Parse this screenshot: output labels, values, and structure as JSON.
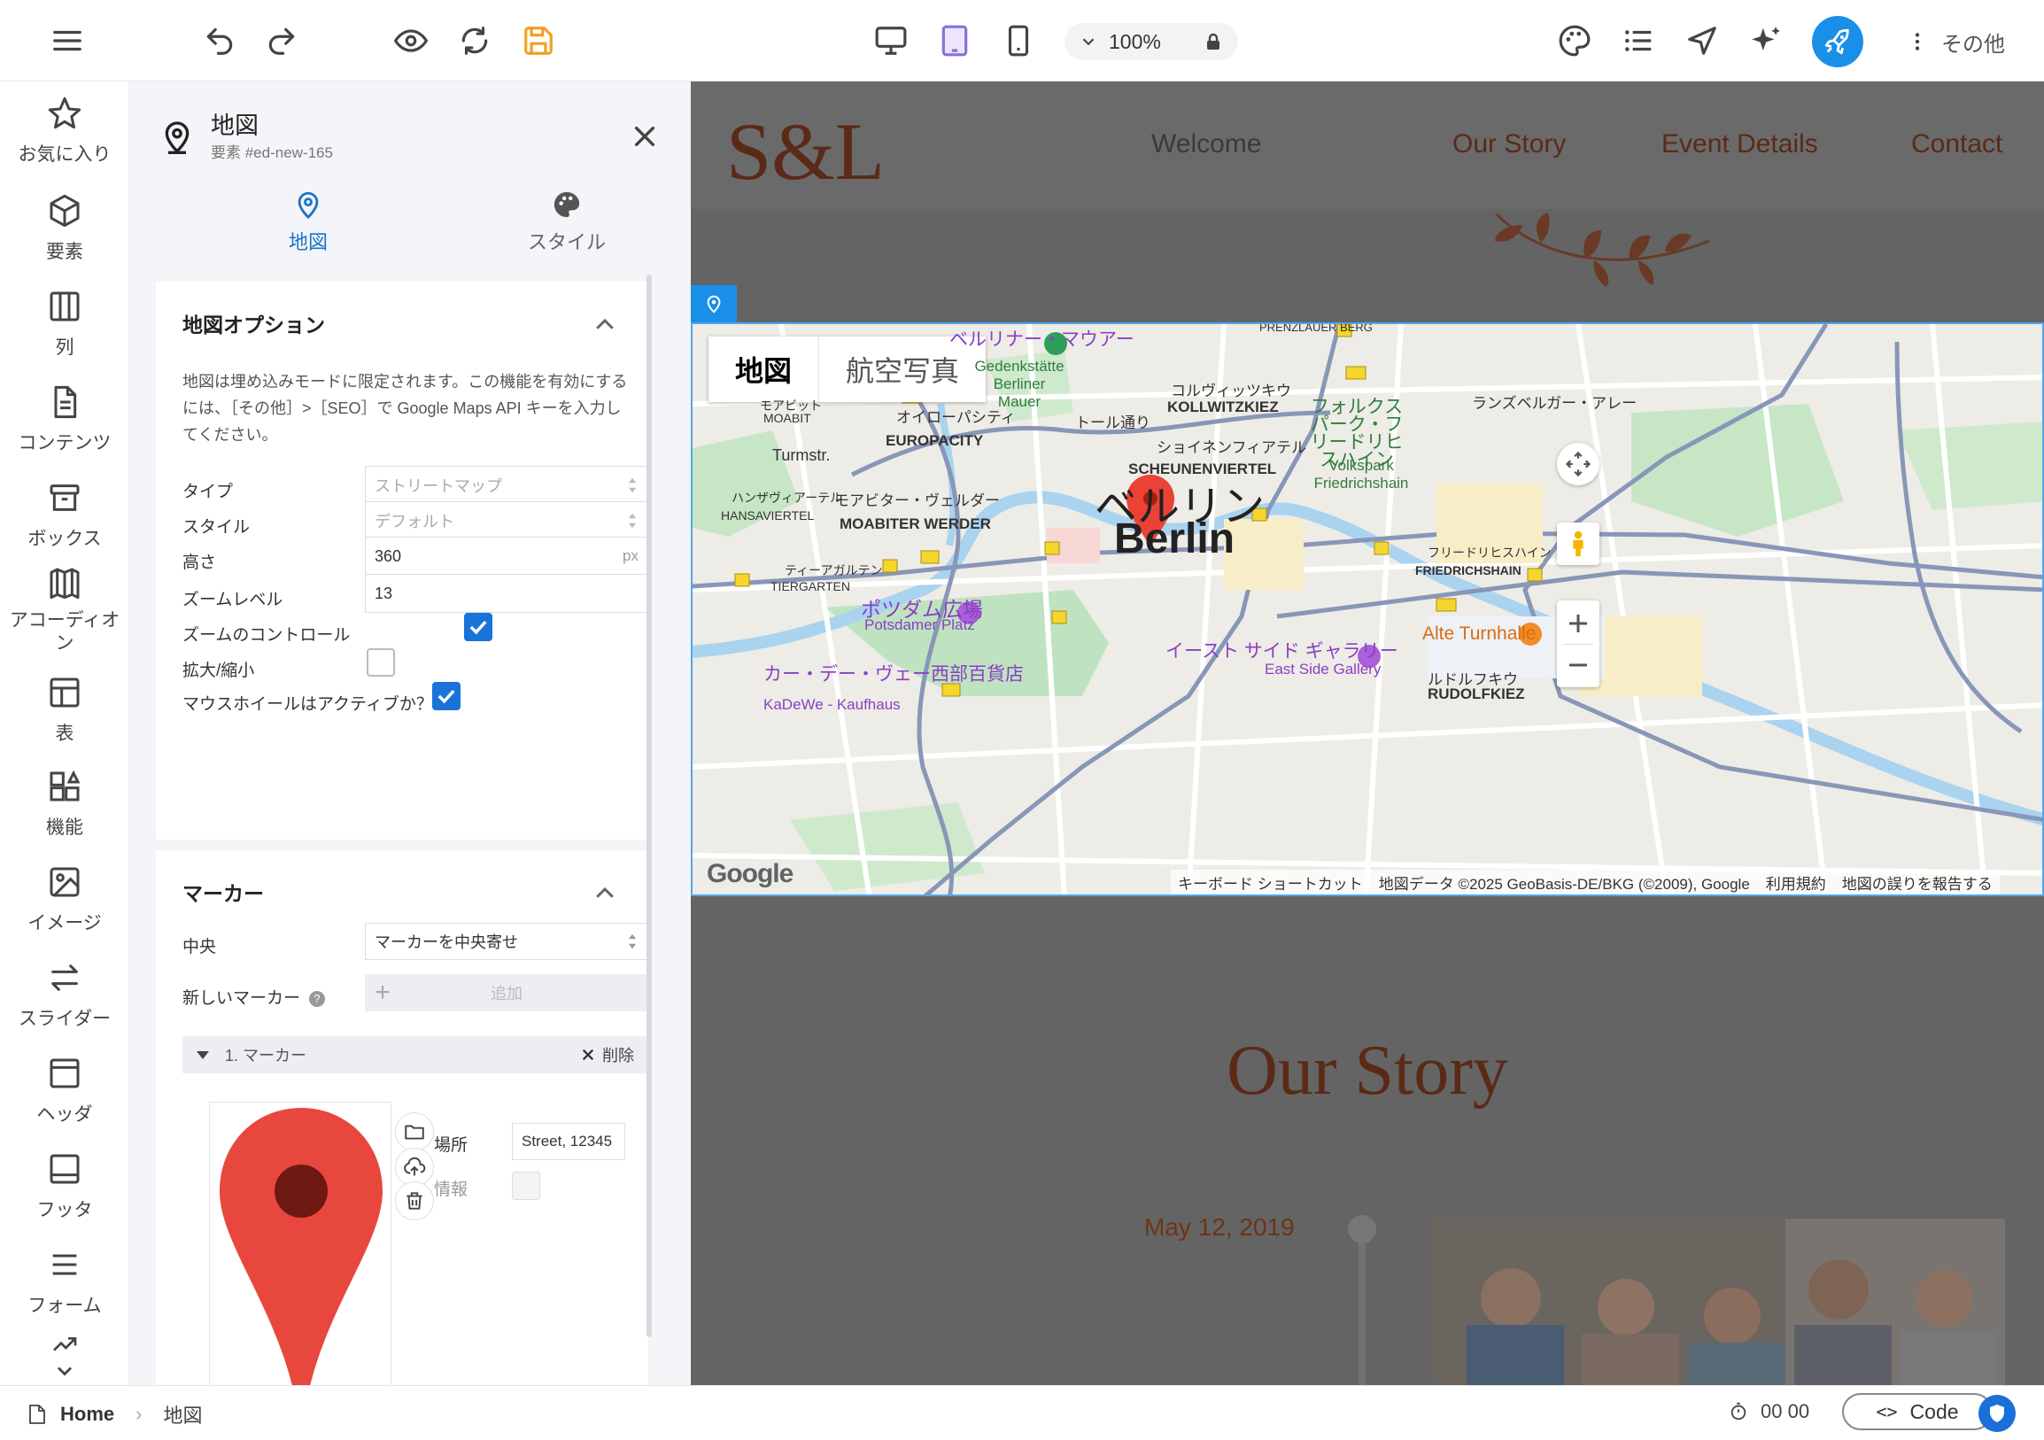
{
  "toolbar": {
    "zoom": "100%",
    "more_label": "その他"
  },
  "rail": [
    {
      "label": "お気に入り"
    },
    {
      "label": "要素"
    },
    {
      "label": "列"
    },
    {
      "label": "コンテンツ"
    },
    {
      "label": "ボックス"
    },
    {
      "label": "アコーディオン"
    },
    {
      "label": "表"
    },
    {
      "label": "機能"
    },
    {
      "label": "イメージ"
    },
    {
      "label": "スライダー"
    },
    {
      "label": "ヘッダ"
    },
    {
      "label": "フッタ"
    },
    {
      "label": "フォーム"
    }
  ],
  "panel": {
    "title": "地図",
    "element_id": "要素 #ed-new-165",
    "tabs": {
      "map": "地図",
      "style": "スタイル"
    },
    "options": {
      "title": "地図オプション",
      "note": "地図は埋め込みモードに限定されます。この機能を有効にするには、［その他］>［SEO］で Google Maps API キーを入力してください。",
      "type_label": "タイプ",
      "type_value": "ストリートマップ",
      "style_label": "スタイル",
      "style_value": "デフォルト",
      "height_label": "高さ",
      "height_value": "360",
      "height_unit": "px",
      "zoom_label": "ズームレベル",
      "zoom_value": "13",
      "zoom_controls_label": "ズームのコントロール",
      "zoom_controls": true,
      "pinch_label": "拡大/縮小",
      "pinch": false,
      "wheel_label": "マウスホイールはアクティブか？",
      "wheel": true
    },
    "markers": {
      "title": "マーカー",
      "center_label": "中央",
      "center_value": "マーカーを中央寄せ",
      "new_label": "新しいマーカー",
      "add_label": "追加",
      "item_label": "1. マーカー",
      "delete_label": "削除",
      "location_label": "場所",
      "location_value": "Street, 12345",
      "info_label": "情報"
    }
  },
  "site": {
    "logo": "S&L",
    "nav": [
      {
        "label": "Welcome",
        "color": "#3a3a3a"
      },
      {
        "label": "Our Story",
        "color": "#5a2a17"
      },
      {
        "label": "Event Details",
        "color": "#5a2a17"
      },
      {
        "label": "Contact",
        "color": "#5a2a17"
      }
    ],
    "story_title": "Our Story",
    "story_date": "May 12, 2019"
  },
  "map": {
    "toggle_map": "地図",
    "toggle_satellite": "航空写真",
    "city_ja": "ベルリン",
    "city_en": "Berlin",
    "labels": {
      "bernauer_ja": "ベルリナー・マウアー",
      "bernauer_de": "Gedenkstätte Berliner Mauer",
      "moabit_ja": "モアビット",
      "moabit": "MOABIT",
      "europacity_ja": "オイローパシティ",
      "europacity": "EUROPACITY",
      "turmstr": "Turmstr.",
      "kollwitz_ja": "コルヴィッツキウ",
      "kollwitz": "KOLLWITZKIEZ",
      "scheunen_ja": "ショイネンフィアテル",
      "scheunen": "SCHEUNENVIERTEL",
      "volkspark_ja": "フォルクスパーク・フリードリヒスハイン",
      "volkspark": "Volkspark Friedrichshain",
      "hansa_ja": "ハンザヴィアーテル",
      "hansa": "HANSAVIERTEL",
      "werder_ja": "モアビター・ヴェルダー",
      "werder": "MOABITER WERDER",
      "tiergarten_ja": "ティーアガルテン",
      "tiergarten": "TIERGARTEN",
      "potsdamer_ja": "ポツダム広場",
      "potsdamer": "Potsdamer Platz",
      "kadewe_ja": "カー・デー・ヴェー西部百貨店",
      "kadewe": "KaDeWe - Kaufhaus",
      "eastside_ja": "イースト サイド ギャラリー",
      "eastside": "East Side Gallery",
      "friedrichshain_ja": "フリードリヒスハイン",
      "friedrichshain": "FRIEDRICHSHAIN",
      "alte": "Alte Turnhalle",
      "rudolf_ja": "ルドルフキウ",
      "rudolf": "RUDOLFKIEZ",
      "prenzlauer": "PRENZLAUER BERG",
      "landsberger": "ランズベルガー・アレー",
      "torstr": "トール通り"
    },
    "footer": {
      "shortcuts": "キーボード ショートカット",
      "data": "地図データ ©2025 GeoBasis-DE/BKG (©2009), Google",
      "terms": "利用規約",
      "report": "地図の誤りを報告する"
    },
    "google": "Google"
  },
  "status": {
    "home": "Home",
    "crumb": "地図",
    "timer": "00 00",
    "code_label": "Code"
  }
}
